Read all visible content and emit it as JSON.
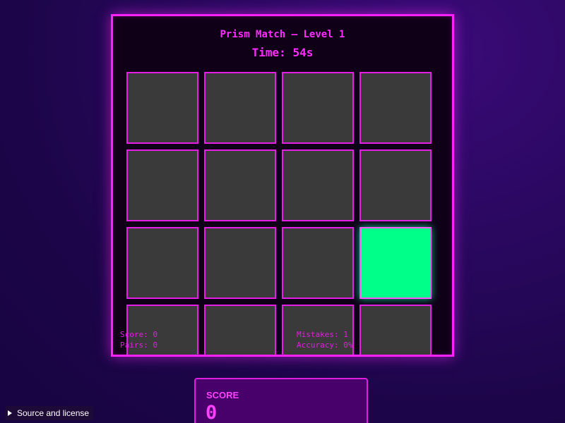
{
  "game": {
    "title": "Prism Match — Level 1",
    "timer": "Time: 54s"
  },
  "board": {
    "rows": 4,
    "cols": 4,
    "cards": [
      {
        "row": 1,
        "col": 1,
        "state": "hidden"
      },
      {
        "row": 1,
        "col": 2,
        "state": "hidden"
      },
      {
        "row": 1,
        "col": 3,
        "state": "hidden"
      },
      {
        "row": 1,
        "col": 4,
        "state": "hidden"
      },
      {
        "row": 2,
        "col": 1,
        "state": "hidden"
      },
      {
        "row": 2,
        "col": 2,
        "state": "hidden"
      },
      {
        "row": 2,
        "col": 3,
        "state": "hidden"
      },
      {
        "row": 2,
        "col": 4,
        "state": "hidden"
      },
      {
        "row": 3,
        "col": 1,
        "state": "hidden"
      },
      {
        "row": 3,
        "col": 2,
        "state": "hidden"
      },
      {
        "row": 3,
        "col": 3,
        "state": "hidden"
      },
      {
        "row": 3,
        "col": 4,
        "state": "revealed",
        "color": "#00ff88"
      },
      {
        "row": 4,
        "col": 1,
        "state": "hidden"
      },
      {
        "row": 4,
        "col": 2,
        "state": "hidden"
      },
      {
        "row": 4,
        "col": 3,
        "state": "hidden"
      },
      {
        "row": 4,
        "col": 4,
        "state": "hidden"
      }
    ]
  },
  "stats": {
    "score": "Score: 0",
    "pairs": "Pairs: 0",
    "mistakes": "Mistakes: 1",
    "accuracy": "Accuracy: 0%"
  },
  "score_panel": {
    "label": "SCORE",
    "value": "0"
  },
  "footer": {
    "source_label": "Source and license"
  },
  "colors": {
    "accent": "#ff2cff",
    "card_back": "#3a3a3a",
    "revealed_card": "#00ff88",
    "background": "#1c0548"
  }
}
